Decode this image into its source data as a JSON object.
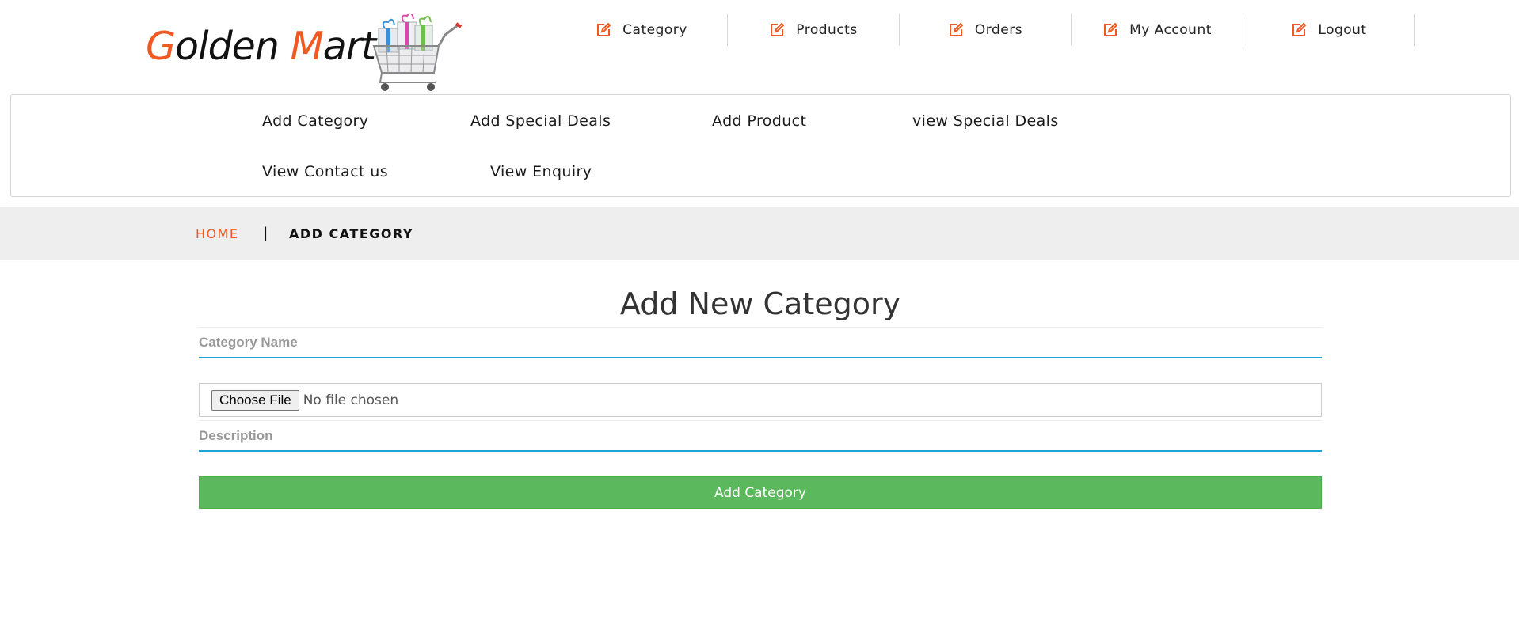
{
  "brand": {
    "first_letter": "G",
    "first_rest": "olden ",
    "second_letter": "M",
    "second_rest": "art"
  },
  "top_nav": [
    {
      "label": "Category",
      "icon": "edit-icon"
    },
    {
      "label": "Products",
      "icon": "edit-icon"
    },
    {
      "label": "Orders",
      "icon": "edit-icon"
    },
    {
      "label": "My Account",
      "icon": "edit-icon"
    },
    {
      "label": "Logout",
      "icon": "edit-icon"
    }
  ],
  "admin_menu": [
    {
      "label": "Add Category"
    },
    {
      "label": "Add Special Deals"
    },
    {
      "label": "Add Product"
    },
    {
      "label": "view Special Deals"
    },
    {
      "label": "View Contact us"
    },
    {
      "label": "View Enquiry"
    }
  ],
  "breadcrumb": {
    "home": "HOME",
    "separator": "|",
    "current": "ADD CATEGORY"
  },
  "form": {
    "title": "Add New Category",
    "category_name_placeholder": "Category Name",
    "file_button": "Choose File",
    "file_status": "No file chosen",
    "description_placeholder": "Description",
    "submit_label": "Add Category"
  },
  "colors": {
    "accent": "#f05a22",
    "input_underline": "#1ca5d8",
    "submit": "#5cb85c",
    "breadcrumb_bg": "#eeeeee"
  }
}
